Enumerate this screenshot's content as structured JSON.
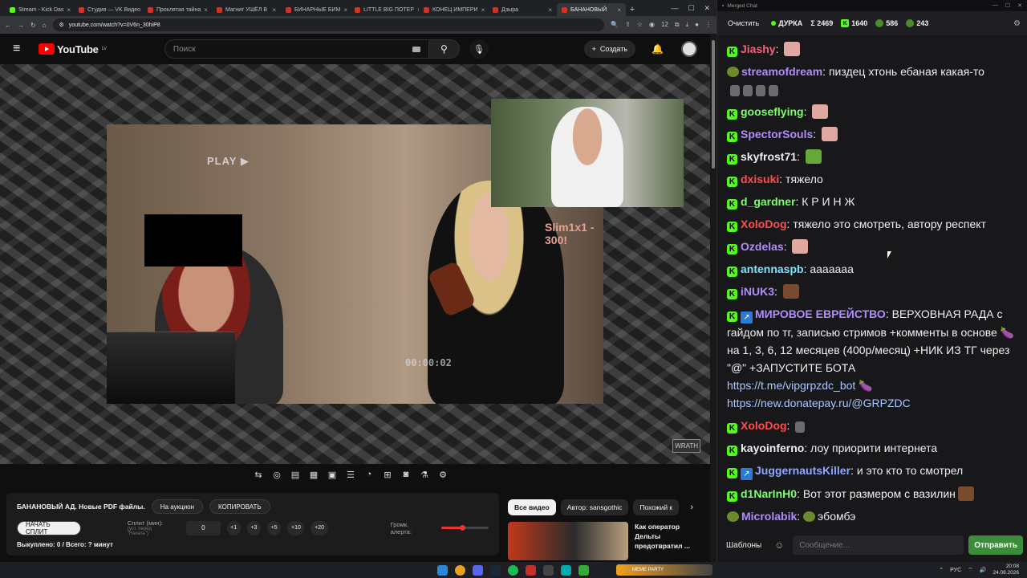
{
  "browser": {
    "tabs": [
      {
        "label": "Stream - Kick Das",
        "color": "#53fc18"
      },
      {
        "label": "Студия — VK Видео",
        "color": "#d93025"
      },
      {
        "label": "Проклятая тайна",
        "color": "#d93025"
      },
      {
        "label": "Магнит УШЁЛ В",
        "color": "#d93025"
      },
      {
        "label": "БИНАРНЫЕ БИМ",
        "color": "#d93025"
      },
      {
        "label": "LITTLE BIG ПОТЕР",
        "color": "#d93025"
      },
      {
        "label": "КОНЕЦ ИМПЕРИ",
        "color": "#d93025"
      },
      {
        "label": "Дзыра",
        "color": "#d93025"
      },
      {
        "label": "БАНАНОВЫЙ",
        "color": "#d93025",
        "active": true
      }
    ],
    "url": "youtube.com/watch?v=0V6n_30hiP8",
    "ext_badge": "12"
  },
  "youtube": {
    "logo_text": "YouTube",
    "logo_region": "LV",
    "search_placeholder": "Поиск",
    "create_label": "Создать"
  },
  "video": {
    "overlay_play": "PLAY ▶",
    "timecode": "00:00:02",
    "donation_text": "Slim1x1 - 300!",
    "watermark": "WRATH"
  },
  "extension": {
    "title": "БАНАНОВЫЙ АД. Новые PDF файлы.",
    "auction_btn": "На аукцион",
    "copy_btn": "КОПИРОВАТЬ",
    "start_split_btn": "НАЧАТЬ СПЛИТ",
    "split_label": "Сплит (мин):",
    "split_hint": "(уст. перед \"Начать\")",
    "split_value": "0",
    "increments": [
      "+1",
      "+3",
      "+5",
      "+10",
      "+20"
    ],
    "alert_volume_label": "Громк. алерта:",
    "alert_volume": 0.45,
    "bought_text": "Выкуплено: 0 / Всего: ? минут"
  },
  "recommendations": {
    "chips": [
      "Все видео",
      "Автор: sansgothic",
      "Похожий к"
    ],
    "first_title": "Как оператор Дельты предотвратил ..."
  },
  "chat": {
    "window_title": "Merged Chat",
    "clear_btn": "Очистить",
    "channel": "ДУРКА",
    "stat_total": "Σ 2469",
    "stat_kick": "1640",
    "stat_twitch": "586",
    "stat_vk": "243",
    "templates_btn": "Шаблоны",
    "input_placeholder": "Сообщение...",
    "send_btn": "Отправить",
    "messages": [
      {
        "nick": "Jiashy",
        "color": "#ff5c7a",
        "text": "",
        "emote": "pink"
      },
      {
        "nick": "streamofdream",
        "color": "#b18cff",
        "text": "пиздец хтонь ебаная какая-то",
        "badge": "pepe",
        "emote_row": true
      },
      {
        "nick": "gooseflying",
        "color": "#7cff6b",
        "text": "",
        "emote": "pink"
      },
      {
        "nick": "SpectorSouls",
        "color": "#b18cff",
        "text": "",
        "emote": "pink"
      },
      {
        "nick": "skyfrost71",
        "color": "#efeff1",
        "text": "",
        "emote": "frog"
      },
      {
        "nick": "dxisuki",
        "color": "#ff4d4d",
        "text": "тяжело"
      },
      {
        "nick": "d_gardner",
        "color": "#7cff6b",
        "text": "К Р И Н Ж"
      },
      {
        "nick": "XoloDog",
        "color": "#ff4d4d",
        "text": "тяжело это смотреть, автору респект"
      },
      {
        "nick": "Ozdelas",
        "color": "#b18cff",
        "text": "",
        "emote": "pink"
      },
      {
        "nick": "antennaspb",
        "color": "#7ee3ff",
        "text": "ааааааа"
      },
      {
        "nick": "iNUK3",
        "color": "#b18cff",
        "text": "",
        "emote": "dark"
      },
      {
        "nick": "МИРОВОЕ ЕВРЕЙСТВО",
        "color": "#b18cff",
        "badge": "blue",
        "text": "ВЕРХОВНАЯ РАДА с гайдом по тг, записью стримов +комменты в основе 🍆 на 1, 3, 6, 12 месяцев (400р/месяц) +НИК ИЗ ТГ через \"@\" +ЗАПУСТИТЕ БОТА",
        "links": [
          "https://t.me/vipgrpzdc_bot 🍆",
          "https://new.donatepay.ru/@GRPZDC"
        ]
      },
      {
        "nick": "XoloDog",
        "color": "#ff4d4d",
        "text": "",
        "emote": "grey"
      },
      {
        "nick": "kayoinferno",
        "color": "#efeff1",
        "text": "лоу приорити интернета"
      },
      {
        "nick": "JuggernautsKiller",
        "color": "#8fa8ff",
        "badge": "blue",
        "text": "и это кто то смотрел"
      },
      {
        "nick": "d1NarInH0",
        "color": "#7cff6b",
        "text": "Вот этот размером с вазилин",
        "emote_after": "dark"
      },
      {
        "nick": "Microlabik",
        "color": "#b18cff",
        "badge": "pepe",
        "text": "эбомбэ",
        "pre_text_badge": true
      }
    ]
  },
  "taskbar": {
    "media_text": "MEME PARTY",
    "lang": "РУС",
    "time": "20:08",
    "date": "24.08.2026"
  }
}
